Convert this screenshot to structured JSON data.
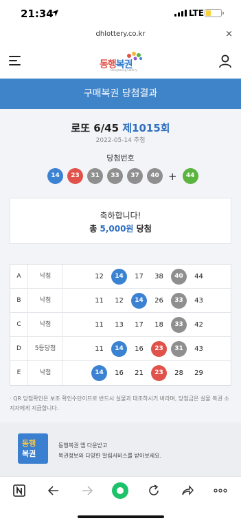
{
  "status": {
    "time": "21:34",
    "network": "LTE"
  },
  "url": {
    "domain": "dhlottery.co.kr",
    "close": "×"
  },
  "header": {
    "logo_text_1": "동행",
    "logo_text_2": "복권",
    "logo_sub": "Donghaeng Lottery"
  },
  "title_band": "구매복권 당첨결과",
  "draw": {
    "game": "로또 6/45",
    "number": "제1015회",
    "date": "2022-05-14 추첨",
    "win_label": "당첨번호",
    "winning_numbers": [
      "14",
      "23",
      "31",
      "33",
      "37",
      "40"
    ],
    "plus": "+",
    "bonus_number": "44"
  },
  "prize": {
    "congrats": "축하합니다!",
    "total_prefix": "총",
    "amount": "5,000원",
    "total_suffix": "당첨"
  },
  "results": [
    {
      "label": "A",
      "status": "낙첨",
      "numbers": [
        "12",
        "14",
        "17",
        "38",
        "40",
        "44"
      ],
      "matched": [
        false,
        true,
        false,
        false,
        true,
        false
      ]
    },
    {
      "label": "B",
      "status": "낙첨",
      "numbers": [
        "11",
        "12",
        "14",
        "26",
        "33",
        "43"
      ],
      "matched": [
        false,
        false,
        true,
        false,
        true,
        false
      ]
    },
    {
      "label": "C",
      "status": "낙첨",
      "numbers": [
        "11",
        "13",
        "17",
        "18",
        "33",
        "42"
      ],
      "matched": [
        false,
        false,
        false,
        false,
        true,
        false
      ]
    },
    {
      "label": "D",
      "status": "5등당첨",
      "numbers": [
        "11",
        "14",
        "16",
        "23",
        "31",
        "43"
      ],
      "matched": [
        false,
        true,
        false,
        true,
        true,
        false
      ]
    },
    {
      "label": "E",
      "status": "낙첨",
      "numbers": [
        "14",
        "16",
        "21",
        "23",
        "28",
        "29"
      ],
      "matched": [
        true,
        false,
        false,
        true,
        false,
        false
      ]
    }
  ],
  "notice": "· QR 당첨확인은 보조 확인수단이므로 반드시 실물과 대조하시기 바라며, 당첨금은 실물 복권 소지자에게 지급합니다.",
  "banner": {
    "icon_line1": "동행",
    "icon_line2": "복권",
    "line1": "동행복권 앱 다운받고",
    "line2": "복권정보와 다양한 알림서비스를 받아보세요."
  },
  "colors": {
    "blue_band": "#3f83c9",
    "ball_10s": "#3b82d2",
    "ball_20s": "#e0524a",
    "ball_30s": "#8f8f8f",
    "ball_40s": "#8f8f8f",
    "bonus": "#5ab43f"
  },
  "icons": [
    "location-arrow-icon",
    "signal-icon",
    "battery-icon",
    "close-icon",
    "menu-icon",
    "user-icon",
    "naver-icon",
    "back-arrow-icon",
    "forward-arrow-icon",
    "green-dot-icon",
    "reload-icon",
    "share-icon",
    "more-icon"
  ]
}
